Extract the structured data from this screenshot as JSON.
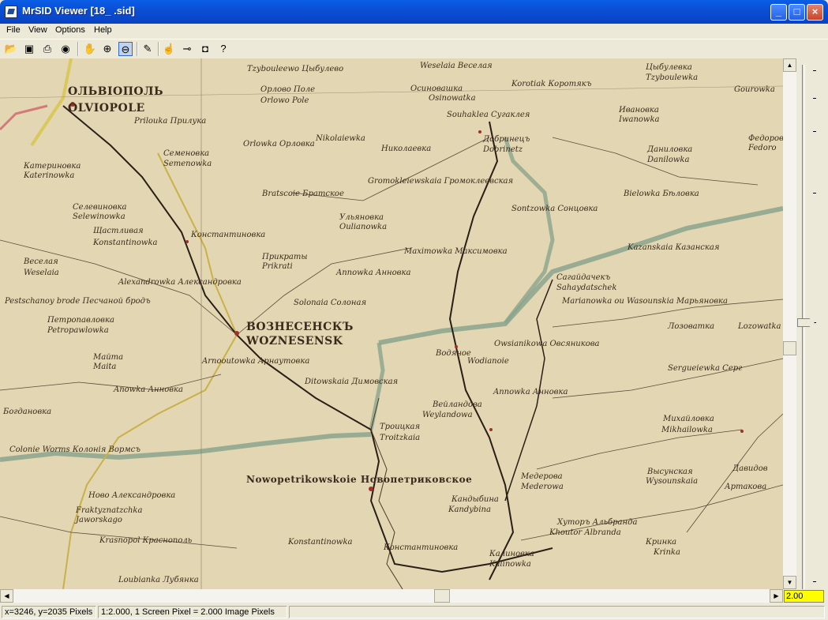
{
  "window": {
    "title": "MrSID Viewer [18_  .sid]",
    "minimize": "_",
    "maximize": "□",
    "close": "×"
  },
  "menu": [
    "File",
    "View",
    "Options",
    "Help"
  ],
  "toolbar": {
    "buttons": [
      {
        "name": "open-folder-icon",
        "glyph": "📂"
      },
      {
        "name": "export-icon",
        "glyph": "▣"
      },
      {
        "name": "print-icon",
        "glyph": "⎙"
      },
      {
        "name": "globe-icon",
        "glyph": "◉"
      },
      {
        "name": "pan-hand-icon",
        "glyph": "✋"
      },
      {
        "name": "zoom-in-icon",
        "glyph": "⊕"
      },
      {
        "name": "zoom-out-icon",
        "glyph": "⊖"
      },
      {
        "name": "pencil-icon",
        "glyph": "✎"
      },
      {
        "name": "pointer-hand-icon",
        "glyph": "☝"
      },
      {
        "name": "measure-icon",
        "glyph": "⊸"
      },
      {
        "name": "snapshot-icon",
        "glyph": "◘"
      },
      {
        "name": "help-icon",
        "glyph": "?"
      }
    ]
  },
  "map": {
    "labels": [
      {
        "text": "ОЛЬВІОПОЛЬ",
        "big": true
      },
      {
        "text": "OLVIOPOLE",
        "big": true
      },
      {
        "text": "Prilouka  Прилука"
      },
      {
        "text": "Семеновка"
      },
      {
        "text": "Semenowka"
      },
      {
        "text": "Катериновка"
      },
      {
        "text": "Katerinowka"
      },
      {
        "text": "Орлово Поле"
      },
      {
        "text": "Orlowo Pole"
      },
      {
        "text": "Tzybouleewo  Цыбулево"
      },
      {
        "text": "Weselaia  Веселая"
      },
      {
        "text": "Осиновашка"
      },
      {
        "text": "Osinowatka"
      },
      {
        "text": "Korotiak  Коротякъ"
      },
      {
        "text": "Цыбулевка"
      },
      {
        "text": "Tzyboulewka"
      },
      {
        "text": "Gourowka"
      },
      {
        "text": "Souhaklea  Сугаклея"
      },
      {
        "text": "Ивановка"
      },
      {
        "text": "Iwanowka"
      },
      {
        "text": "Orlowka  Орловка"
      },
      {
        "text": "Nikolaiewka"
      },
      {
        "text": "Николаевка"
      },
      {
        "text": "Добринецъ"
      },
      {
        "text": "Dobrinetz"
      },
      {
        "text": "Даниловка"
      },
      {
        "text": "Danilowka"
      },
      {
        "text": "Федоров"
      },
      {
        "text": "Fedorо"
      },
      {
        "text": "Bratscoie  Братское"
      },
      {
        "text": "Gromokleiewskaia  Громоклеевская"
      },
      {
        "text": "Sontzowka  Сонцовка"
      },
      {
        "text": "Bielowka  Бѣловка"
      },
      {
        "text": "Селевиновка"
      },
      {
        "text": "Selewinowka"
      },
      {
        "text": "Щастливая"
      },
      {
        "text": "Konstantinowka"
      },
      {
        "text": "Константиновка"
      },
      {
        "text": "Ульяновка"
      },
      {
        "text": "Oulianowka"
      },
      {
        "text": "Kazanskaia  Казанская"
      },
      {
        "text": "Прикраты"
      },
      {
        "text": "Prikrati"
      },
      {
        "text": "Maximowka  Максимовка"
      },
      {
        "text": "Веселая"
      },
      {
        "text": "Weselaia"
      },
      {
        "text": "Annowka  Анновка"
      },
      {
        "text": "Сагайдачекъ"
      },
      {
        "text": "Sahaydatschek"
      },
      {
        "text": "Alexandrowka  Александровка"
      },
      {
        "text": "Marianowka ou Wasounskia  Марьяновка"
      },
      {
        "text": "Pestschanoy brode  Песчаной бродъ"
      },
      {
        "text": "Solonaia  Солоная"
      },
      {
        "text": "Петропавловка"
      },
      {
        "text": "Petropawlowka"
      },
      {
        "text": "ВОЗНЕСЕНСКЪ",
        "big": true
      },
      {
        "text": "WOZNESENSK",
        "big": true
      },
      {
        "text": "Лозоватка"
      },
      {
        "text": "Lozowatka"
      },
      {
        "text": "Owsianikowa  Овсяникова"
      },
      {
        "text": "Водяное"
      },
      {
        "text": "Wodianoie"
      },
      {
        "text": "Майта"
      },
      {
        "text": "Maita"
      },
      {
        "text": "Arnooutowka  Арнаутовка"
      },
      {
        "text": "Sergueiewka  Серг"
      },
      {
        "text": "Ditowskaia  Димовская"
      },
      {
        "text": "Annowka  Анновка"
      },
      {
        "text": "Anowka  Анновка"
      },
      {
        "text": "Вейландова"
      },
      {
        "text": "Weylandowa"
      },
      {
        "text": "Михайловка"
      },
      {
        "text": "Mikhailowka"
      },
      {
        "text": "Богдановка"
      },
      {
        "text": "Троицкая"
      },
      {
        "text": "Troitzkaia"
      },
      {
        "text": "Colonie Worms  Колонія Вормсъ"
      },
      {
        "text": "Nowopetrikowskoie  Новопетриковское",
        "big": true
      },
      {
        "text": "Медерова"
      },
      {
        "text": "Mederowa"
      },
      {
        "text": "Высунская"
      },
      {
        "text": "Wysounskaia"
      },
      {
        "text": "Давидов"
      },
      {
        "text": "Артакова"
      },
      {
        "text": "Ново Александровка"
      },
      {
        "text": "Fraktyznatzchka"
      },
      {
        "text": "Jaworskago"
      },
      {
        "text": "Кандыбина"
      },
      {
        "text": "Kandybina"
      },
      {
        "text": "Хуторъ Альбранда"
      },
      {
        "text": "Khoutor Albranda"
      },
      {
        "text": "Krasnopol  Краснополь"
      },
      {
        "text": "Konstantinowka"
      },
      {
        "text": "Константиновка"
      },
      {
        "text": "Калиновка"
      },
      {
        "text": "Kalinowka"
      },
      {
        "text": "Кринка"
      },
      {
        "text": "Krinka"
      },
      {
        "text": "Loubianka  Лубянка"
      }
    ]
  },
  "zoom": {
    "value": "2.00",
    "level_fraction": 0.5
  },
  "status": {
    "coords": "x=3246, y=2035 Pixels",
    "scale": "1:2.000,  1 Screen Pixel = 2.000 Image Pixels"
  }
}
